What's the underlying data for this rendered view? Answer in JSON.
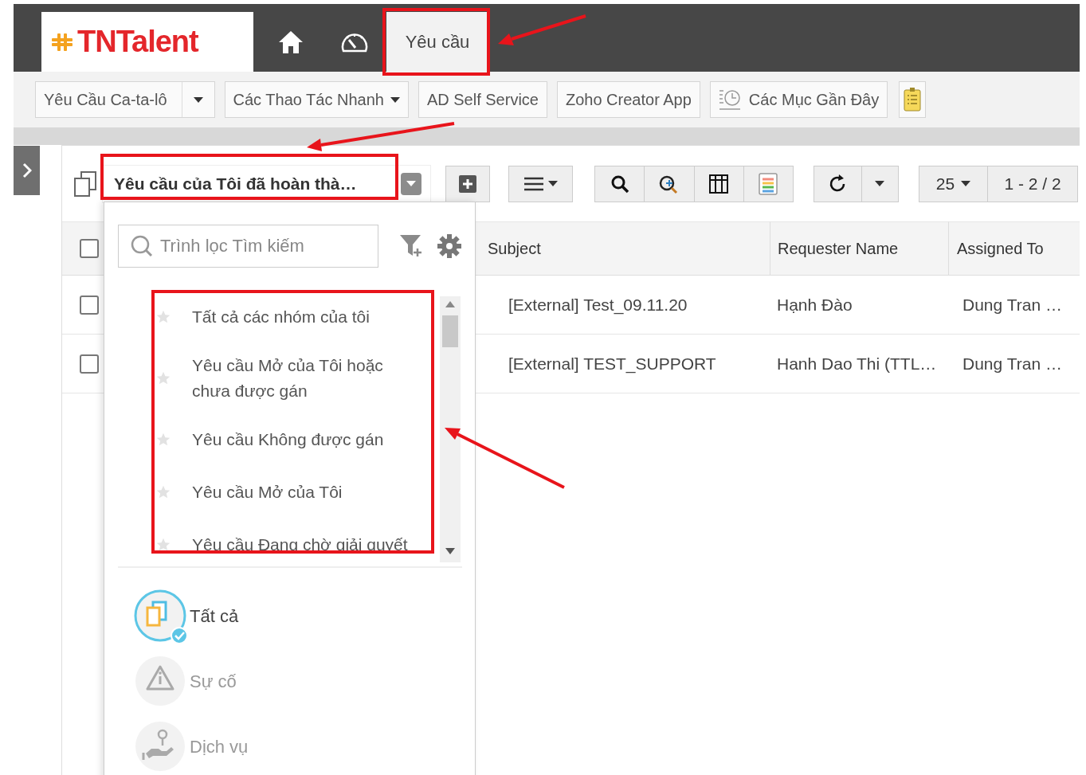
{
  "topbar": {
    "logo_text": "TNTalent",
    "tabs": [
      {
        "kind": "home",
        "selected": false
      },
      {
        "kind": "dashboard",
        "selected": false
      },
      {
        "kind": "text",
        "label": "Yêu cầu",
        "selected": true
      }
    ]
  },
  "toolbar": {
    "buttons": [
      {
        "kind": "split",
        "label": "Yêu Cầu Ca-ta-lô"
      },
      {
        "kind": "dropdown",
        "label": "Các Thao Tác Nhanh"
      },
      {
        "kind": "plain",
        "label": "AD Self Service"
      },
      {
        "kind": "plain",
        "label": "Zoho Creator App"
      },
      {
        "kind": "recent",
        "label": "Các Mục Gần Đây"
      },
      {
        "kind": "notes"
      }
    ]
  },
  "list_view": {
    "view_title": "Yêu cầu của Tôi đã hoàn thà…",
    "page_size": "25",
    "range": "1 - 2 / 2",
    "select_all_checked": false,
    "columns": [
      "Subject",
      "Requester Name",
      "Assigned To"
    ],
    "rows": [
      {
        "checked": false,
        "subject": "[External] Test_09.11.20",
        "requester": "Hạnh Đào",
        "assigned": "Dung Tran …"
      },
      {
        "checked": false,
        "subject": "[External] TEST_SUPPORT",
        "requester": "Hanh Dao Thi (TTL…",
        "assigned": "Dung Tran …"
      }
    ]
  },
  "filter_menu": {
    "search_placeholder": "Trình lọc Tìm kiếm",
    "filters": [
      {
        "label": "Tất cả các nhóm của tôi",
        "starred": false
      },
      {
        "label": "Yêu cầu Mở của Tôi hoặc\nchưa được gán",
        "starred": false
      },
      {
        "label": "Yêu cầu Không được gán",
        "starred": false
      },
      {
        "label": "Yêu cầu Mở của Tôi",
        "starred": false
      },
      {
        "label": "Yêu cầu Đang chờ giải quyết",
        "starred": false
      }
    ],
    "categories": [
      {
        "kind": "all",
        "label": "Tất cả",
        "selected": true
      },
      {
        "kind": "incident",
        "label": "Sự cố",
        "selected": false
      },
      {
        "kind": "service",
        "label": "Dịch vụ",
        "selected": false
      }
    ]
  }
}
